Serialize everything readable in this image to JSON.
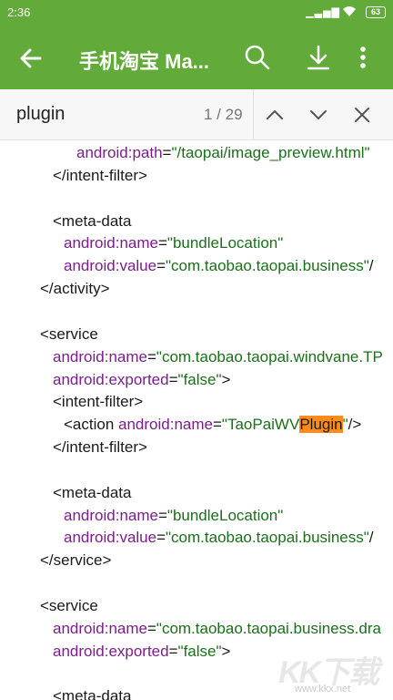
{
  "status": {
    "time": "2:36",
    "battery": "63"
  },
  "appbar": {
    "title": "手机淘宝 Ma..."
  },
  "find": {
    "query": "plugin",
    "count": "1 / 29"
  },
  "code": [
    {
      "indent": 84,
      "parts": [
        {
          "c": "attr",
          "t": "android:"
        },
        {
          "c": "attr",
          "t": "path"
        },
        {
          "c": "tag",
          "t": "="
        },
        {
          "c": "val",
          "t": "\"/taopai/image_preview.html\""
        }
      ]
    },
    {
      "indent": 58,
      "parts": [
        {
          "c": "tag",
          "t": "</intent-filter>"
        }
      ]
    },
    {
      "indent": 58,
      "parts": []
    },
    {
      "indent": 58,
      "parts": [
        {
          "c": "tag",
          "t": "<meta-data"
        }
      ]
    },
    {
      "indent": 70,
      "parts": [
        {
          "c": "attr",
          "t": "android:"
        },
        {
          "c": "attr",
          "t": "name"
        },
        {
          "c": "tag",
          "t": "="
        },
        {
          "c": "val",
          "t": "\"bundleLocation\""
        }
      ]
    },
    {
      "indent": 70,
      "parts": [
        {
          "c": "attr",
          "t": "android:"
        },
        {
          "c": "attr",
          "t": "value"
        },
        {
          "c": "tag",
          "t": "="
        },
        {
          "c": "val",
          "t": "\"com.taobao.taopai.business\""
        },
        {
          "c": "tag",
          "t": "/"
        }
      ]
    },
    {
      "indent": 44,
      "parts": [
        {
          "c": "tag",
          "t": "</activity>"
        }
      ]
    },
    {
      "indent": 44,
      "parts": []
    },
    {
      "indent": 44,
      "parts": [
        {
          "c": "tag",
          "t": "<service"
        }
      ]
    },
    {
      "indent": 58,
      "parts": [
        {
          "c": "attr",
          "t": "android:"
        },
        {
          "c": "attr",
          "t": "name"
        },
        {
          "c": "tag",
          "t": "="
        },
        {
          "c": "val",
          "t": "\"com.taobao.taopai.windvane.TP"
        }
      ]
    },
    {
      "indent": 58,
      "parts": [
        {
          "c": "attr",
          "t": "android:"
        },
        {
          "c": "attr",
          "t": "exported"
        },
        {
          "c": "tag",
          "t": "="
        },
        {
          "c": "val",
          "t": "\"false\""
        },
        {
          "c": "tag",
          "t": ">"
        }
      ]
    },
    {
      "indent": 58,
      "parts": [
        {
          "c": "tag",
          "t": "<intent-filter>"
        }
      ]
    },
    {
      "indent": 70,
      "parts": [
        {
          "c": "tag",
          "t": "<action "
        },
        {
          "c": "attr",
          "t": "android:"
        },
        {
          "c": "attr",
          "t": "name"
        },
        {
          "c": "tag",
          "t": "="
        },
        {
          "c": "val",
          "t": "\"TaoPaiWV"
        },
        {
          "c": "hl",
          "t": "Plugin"
        },
        {
          "c": "val",
          "t": "\""
        },
        {
          "c": "tag",
          "t": "/>"
        }
      ]
    },
    {
      "indent": 58,
      "parts": [
        {
          "c": "tag",
          "t": "</intent-filter>"
        }
      ]
    },
    {
      "indent": 58,
      "parts": []
    },
    {
      "indent": 58,
      "parts": [
        {
          "c": "tag",
          "t": "<meta-data"
        }
      ]
    },
    {
      "indent": 70,
      "parts": [
        {
          "c": "attr",
          "t": "android:"
        },
        {
          "c": "attr",
          "t": "name"
        },
        {
          "c": "tag",
          "t": "="
        },
        {
          "c": "val",
          "t": "\"bundleLocation\""
        }
      ]
    },
    {
      "indent": 70,
      "parts": [
        {
          "c": "attr",
          "t": "android:"
        },
        {
          "c": "attr",
          "t": "value"
        },
        {
          "c": "tag",
          "t": "="
        },
        {
          "c": "val",
          "t": "\"com.taobao.taopai.business\""
        },
        {
          "c": "tag",
          "t": "/"
        }
      ]
    },
    {
      "indent": 44,
      "parts": [
        {
          "c": "tag",
          "t": "</service>"
        }
      ]
    },
    {
      "indent": 44,
      "parts": []
    },
    {
      "indent": 44,
      "parts": [
        {
          "c": "tag",
          "t": "<service"
        }
      ]
    },
    {
      "indent": 58,
      "parts": [
        {
          "c": "attr",
          "t": "android:"
        },
        {
          "c": "attr",
          "t": "name"
        },
        {
          "c": "tag",
          "t": "="
        },
        {
          "c": "val",
          "t": "\"com.taobao.taopai.business.dra"
        }
      ]
    },
    {
      "indent": 58,
      "parts": [
        {
          "c": "attr",
          "t": "android:"
        },
        {
          "c": "attr",
          "t": "exported"
        },
        {
          "c": "tag",
          "t": "="
        },
        {
          "c": "val",
          "t": "\"false\""
        },
        {
          "c": "tag",
          "t": ">"
        }
      ]
    },
    {
      "indent": 58,
      "parts": []
    },
    {
      "indent": 58,
      "parts": [
        {
          "c": "tag",
          "t": "<meta-data"
        }
      ]
    }
  ],
  "watermark": {
    "logo": "KK下载",
    "url": "www.kkx.net"
  }
}
